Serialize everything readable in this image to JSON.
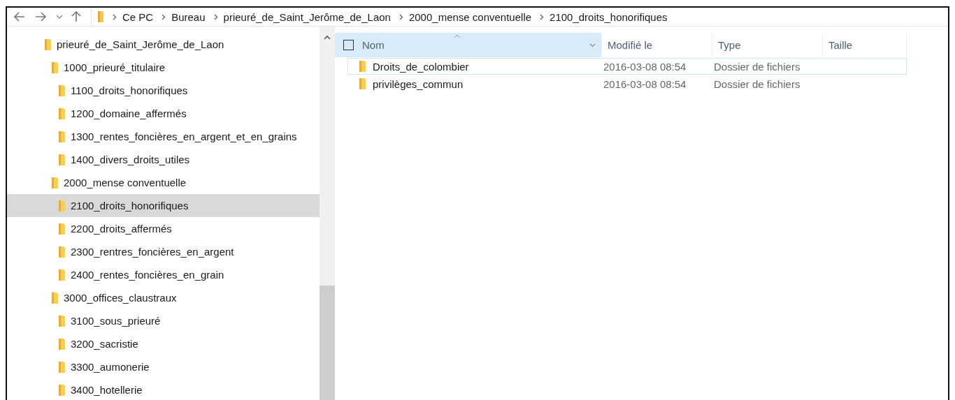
{
  "nav": {
    "breadcrumbs": [
      "Ce PC",
      "Bureau",
      "prieuré_de_Saint_Jerôme_de_Laon",
      "2000_mense conventuelle",
      "2100_droits_honorifiques"
    ]
  },
  "tree": [
    {
      "label": "prieuré_de_Saint_Jerôme_de_Laon",
      "selected": false,
      "children": [
        {
          "label": "1000_prieuré_titulaire",
          "selected": false,
          "children": [
            {
              "label": "1100_droits_honorifiques",
              "selected": false
            },
            {
              "label": "1200_domaine_affermés",
              "selected": false
            },
            {
              "label": "1300_rentes_foncières_en_argent_et_en_grains",
              "selected": false
            },
            {
              "label": "1400_divers_droits_utiles",
              "selected": false
            }
          ]
        },
        {
          "label": "2000_mense conventuelle",
          "selected": false,
          "children": [
            {
              "label": "2100_droits_honorifiques",
              "selected": true
            },
            {
              "label": "2200_droits_affermés",
              "selected": false
            },
            {
              "label": "2300_rentres_foncières_en_argent",
              "selected": false
            },
            {
              "label": "2400_rentes_foncières_en_grain",
              "selected": false
            }
          ]
        },
        {
          "label": "3000_offices_claustraux",
          "selected": false,
          "children": [
            {
              "label": "3100_sous_prieuré",
              "selected": false
            },
            {
              "label": "3200_sacristie",
              "selected": false
            },
            {
              "label": "3300_aumonerie",
              "selected": false
            },
            {
              "label": "3400_hotellerie",
              "selected": false
            }
          ]
        }
      ]
    }
  ],
  "table": {
    "select_all": {
      "checked": false
    },
    "columns": [
      {
        "label": "Nom",
        "sorted": true
      },
      {
        "label": "Modifié le",
        "sorted": false
      },
      {
        "label": "Type",
        "sorted": false
      },
      {
        "label": "Taille",
        "sorted": false
      }
    ],
    "rows": [
      {
        "name": "Droits_de_colombier",
        "modified": "2016-03-08 08:54",
        "type": "Dossier de fichiers",
        "focused": true
      },
      {
        "name": "privilèges_commun",
        "modified": "2016-03-08 08:54",
        "type": "Dossier de fichiers",
        "focused": false
      }
    ]
  }
}
